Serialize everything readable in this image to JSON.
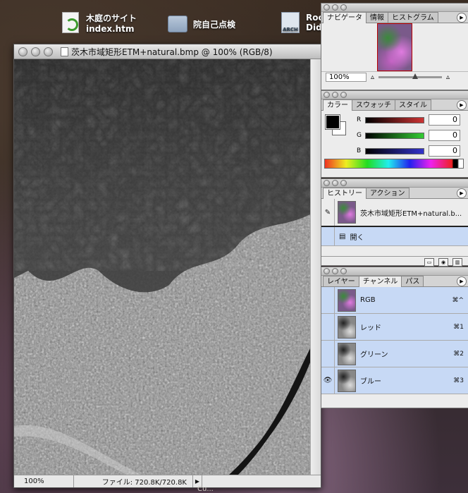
{
  "desktop": {
    "icons": [
      {
        "label_line1": "木庭のサイト",
        "label_line2": "index.htm"
      },
      {
        "label_line1": "院自己点検",
        "label_line2": ""
      },
      {
        "label_line1": "Roc",
        "label_line2": "Did",
        "badge": "ARCH"
      }
    ],
    "bottom_text": "Cu..."
  },
  "document": {
    "title": "茨木市域矩形ETM+natural.bmp @ 100% (RGB/8)",
    "zoom": "100%",
    "file_info": "ファイル: 720.8K/720.8K"
  },
  "navigator": {
    "tabs": [
      "ナビゲータ",
      "情報",
      "ヒストグラム"
    ],
    "zoom": "100%"
  },
  "color": {
    "tabs": [
      "カラー",
      "スウォッチ",
      "スタイル"
    ],
    "channels": [
      {
        "label": "R",
        "value": "0",
        "gradient": "#aa2222"
      },
      {
        "label": "G",
        "value": "0",
        "gradient": "#22aa22"
      },
      {
        "label": "B",
        "value": "0",
        "gradient": "#2222aa"
      }
    ]
  },
  "history": {
    "tabs": [
      "ヒストリー",
      "アクション"
    ],
    "snapshot": "茨木市域矩形ETM+natural.b...",
    "states": [
      "開く"
    ]
  },
  "channels": {
    "tabs": [
      "レイヤー",
      "チャンネル",
      "パス"
    ],
    "rows": [
      {
        "name": "RGB",
        "shortcut": "⌘^",
        "thumb": "color",
        "visible": false
      },
      {
        "name": "レッド",
        "shortcut": "⌘1",
        "thumb": "gray",
        "visible": false
      },
      {
        "name": "グリーン",
        "shortcut": "⌘2",
        "thumb": "gray",
        "visible": false
      },
      {
        "name": "ブルー",
        "shortcut": "⌘3",
        "thumb": "gray",
        "visible": true
      }
    ]
  }
}
